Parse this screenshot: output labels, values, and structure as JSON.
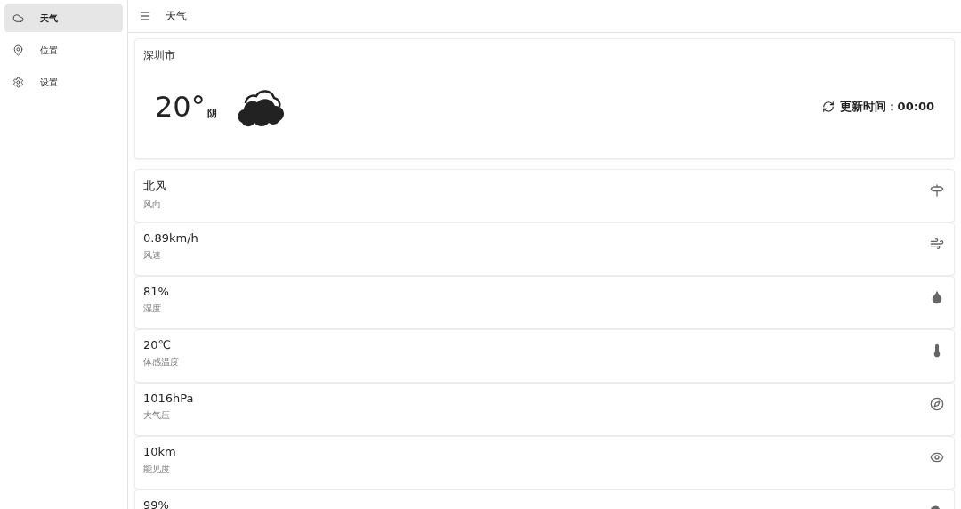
{
  "sidebar": {
    "items": [
      {
        "label": "天气",
        "kind": "cloud",
        "selected": true
      },
      {
        "label": "位置",
        "kind": "pin",
        "selected": false
      },
      {
        "label": "设置",
        "kind": "gear",
        "selected": false
      }
    ]
  },
  "header": {
    "title": "天气"
  },
  "current": {
    "city": "深圳市",
    "temperature": "20°",
    "condition": "阴",
    "update_label": "更新时间：00:00"
  },
  "details": [
    {
      "value": "北风",
      "label": "风向",
      "kind": "wind-direction"
    },
    {
      "value": "0.89km/h",
      "label": "风速",
      "kind": "wind-speed"
    },
    {
      "value": "81%",
      "label": "湿度",
      "kind": "humidity"
    },
    {
      "value": "20℃",
      "label": "体感温度",
      "kind": "feels-like"
    },
    {
      "value": "1016hPa",
      "label": "大气压",
      "kind": "pressure"
    },
    {
      "value": "10km",
      "label": "能见度",
      "kind": "visibility"
    },
    {
      "value": "99%",
      "kind": "cloud"
    }
  ]
}
